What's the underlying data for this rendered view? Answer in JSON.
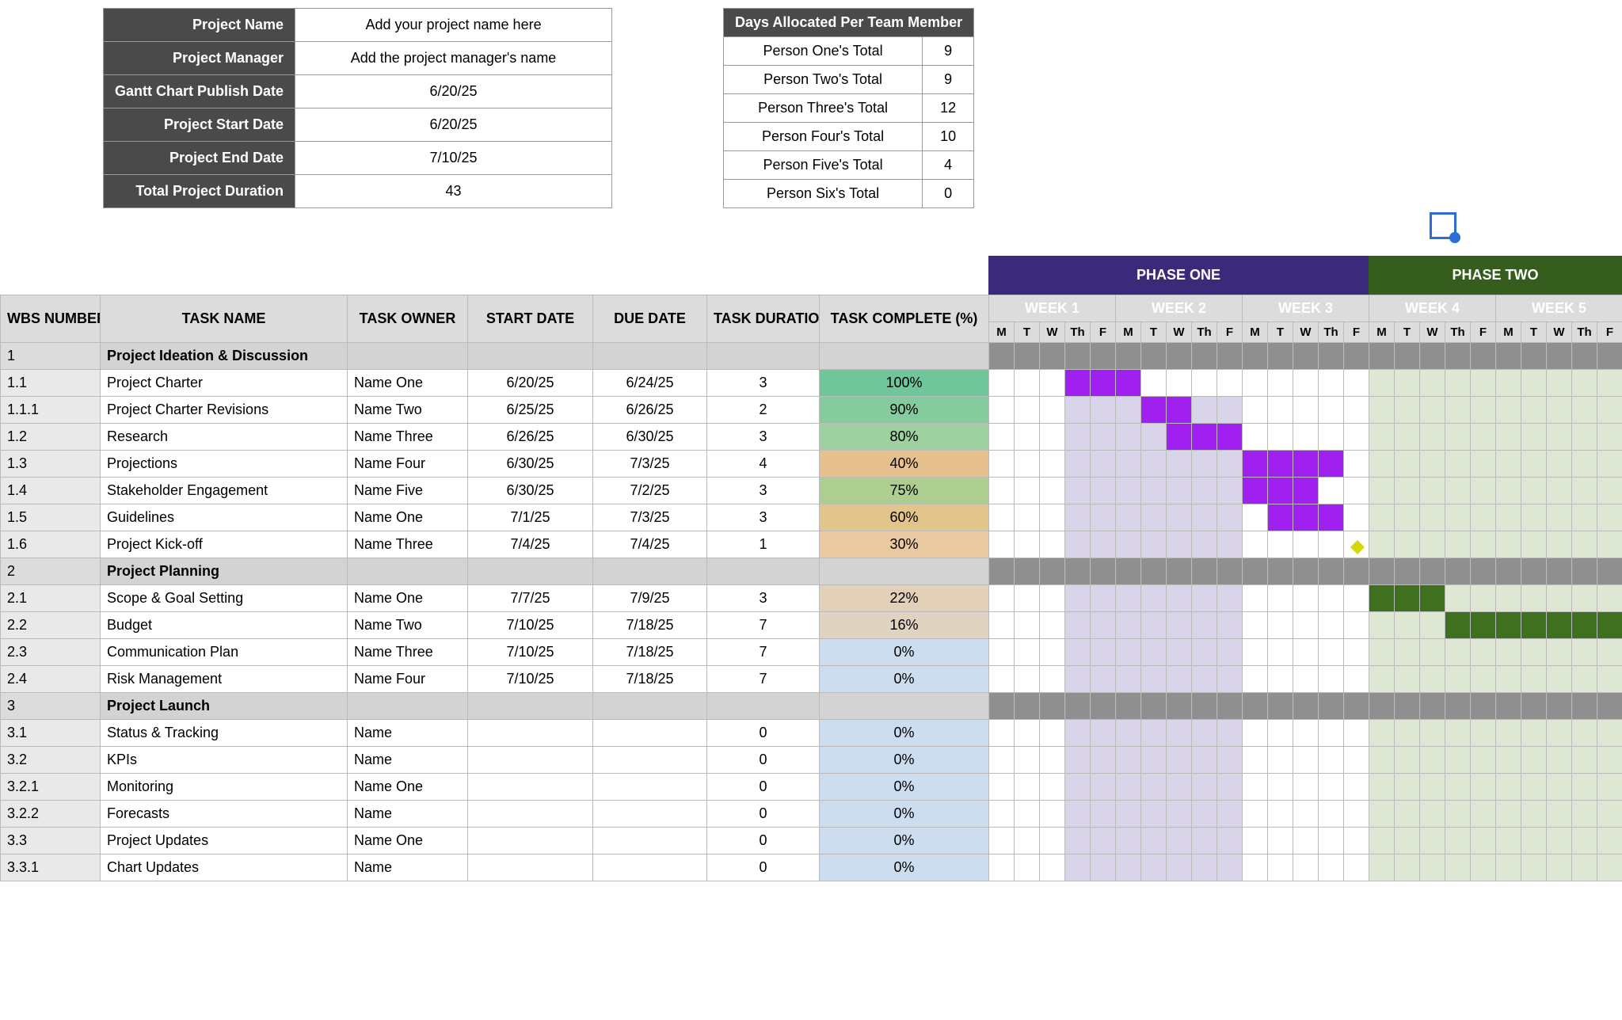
{
  "project_info": {
    "labels": {
      "name": "Project Name",
      "manager": "Project Manager",
      "publish": "Gantt Chart Publish Date",
      "start": "Project Start Date",
      "end": "Project End Date",
      "duration": "Total Project Duration"
    },
    "values": {
      "name": "Add your project name here",
      "manager": "Add the project manager's name",
      "publish": "6/20/25",
      "start": "6/20/25",
      "end": "7/10/25",
      "duration": "43"
    }
  },
  "team_alloc": {
    "header": "Days Allocated Per Team Member",
    "rows": [
      {
        "label": "Person One's Total",
        "days": "9"
      },
      {
        "label": "Person Two's Total",
        "days": "9"
      },
      {
        "label": "Person Three's Total",
        "days": "12"
      },
      {
        "label": "Person Four's Total",
        "days": "10"
      },
      {
        "label": "Person Five's Total",
        "days": "4"
      },
      {
        "label": "Person Six's Total",
        "days": "0"
      }
    ]
  },
  "phases": [
    {
      "label": "PHASE ONE",
      "class": "phase-purple",
      "span": 15
    },
    {
      "label": "PHASE TWO",
      "class": "phase-green",
      "span": 10
    }
  ],
  "columns": {
    "wbs": "WBS NUMBER",
    "task": "TASK NAME",
    "owner": "TASK OWNER",
    "start": "START DATE",
    "due": "DUE DATE",
    "duration": "TASK DURATION",
    "pct": "TASK COMPLETE (%)"
  },
  "weeks": [
    {
      "label": "WEEK 1",
      "class": "week-hdr-purple",
      "days": [
        "M",
        "T",
        "W",
        "Th",
        "F"
      ]
    },
    {
      "label": "WEEK 2",
      "class": "week-hdr-purple",
      "days": [
        "M",
        "T",
        "W",
        "Th",
        "F"
      ]
    },
    {
      "label": "WEEK 3",
      "class": "week-hdr-purple",
      "days": [
        "M",
        "T",
        "W",
        "Th",
        "F"
      ]
    },
    {
      "label": "WEEK 4",
      "class": "week-hdr-green",
      "days": [
        "M",
        "T",
        "W",
        "Th",
        "F"
      ]
    },
    {
      "label": "WEEK 5",
      "class": "week-hdr-green",
      "days": [
        "M",
        "T",
        "W",
        "Th",
        "F"
      ]
    }
  ],
  "chart_data": {
    "type": "gantt",
    "days_total": 25,
    "phase_one_days": 15,
    "rows": [
      {
        "section": true,
        "wbs": "1",
        "task": "Project Ideation & Discussion"
      },
      {
        "wbs": "1.1",
        "task": "Project Charter",
        "owner": "Name One",
        "start": "6/20/25",
        "due": "6/24/25",
        "dur": "3",
        "pct": "100%",
        "pct_cls": "pct-100",
        "bar_start": 3,
        "bar_len": 3,
        "shade_from": 0,
        "shade_to": 0
      },
      {
        "wbs": "1.1.1",
        "task": "Project Charter Revisions",
        "owner": "Name Two",
        "start": "6/25/25",
        "due": "6/26/25",
        "dur": "2",
        "pct": "90%",
        "pct_cls": "pct-90",
        "bar_start": 6,
        "bar_len": 2,
        "shade_from": 3,
        "shade_to": 10
      },
      {
        "wbs": "1.2",
        "task": "Research",
        "owner": "Name Three",
        "start": "6/26/25",
        "due": "6/30/25",
        "dur": "3",
        "pct": "80%",
        "pct_cls": "pct-80",
        "bar_start": 7,
        "bar_len": 3,
        "shade_from": 3,
        "shade_to": 10
      },
      {
        "wbs": "1.3",
        "task": "Projections",
        "owner": "Name Four",
        "start": "6/30/25",
        "due": "7/3/25",
        "dur": "4",
        "pct": "40%",
        "pct_cls": "pct-40",
        "bar_start": 10,
        "bar_len": 4,
        "shade_from": 3,
        "shade_to": 10
      },
      {
        "wbs": "1.4",
        "task": "Stakeholder Engagement",
        "owner": "Name Five",
        "start": "6/30/25",
        "due": "7/2/25",
        "dur": "3",
        "pct": "75%",
        "pct_cls": "pct-75",
        "bar_start": 10,
        "bar_len": 3,
        "shade_from": 3,
        "shade_to": 10
      },
      {
        "wbs": "1.5",
        "task": "Guidelines",
        "owner": "Name One",
        "start": "7/1/25",
        "due": "7/3/25",
        "dur": "3",
        "pct": "60%",
        "pct_cls": "pct-60",
        "bar_start": 11,
        "bar_len": 3,
        "shade_from": 3,
        "shade_to": 10
      },
      {
        "wbs": "1.6",
        "task": "Project Kick-off",
        "owner": "Name Three",
        "start": "7/4/25",
        "due": "7/4/25",
        "dur": "1",
        "pct": "30%",
        "pct_cls": "pct-30",
        "milestone_at": 14,
        "shade_from": 3,
        "shade_to": 10
      },
      {
        "section": true,
        "wbs": "2",
        "task": "Project Planning"
      },
      {
        "wbs": "2.1",
        "task": "Scope & Goal Setting",
        "owner": "Name One",
        "start": "7/7/25",
        "due": "7/9/25",
        "dur": "3",
        "pct": "22%",
        "pct_cls": "pct-22",
        "bar_start": 15,
        "bar_len": 3,
        "bar_cls": "bar-green",
        "shade_from": 3,
        "shade_to": 10
      },
      {
        "wbs": "2.2",
        "task": "Budget",
        "owner": "Name Two",
        "start": "7/10/25",
        "due": "7/18/25",
        "dur": "7",
        "pct": "16%",
        "pct_cls": "pct-16",
        "bar_start": 18,
        "bar_len": 7,
        "bar_cls": "bar-green",
        "shade_from": 3,
        "shade_to": 10
      },
      {
        "wbs": "2.3",
        "task": "Communication Plan",
        "owner": "Name Three",
        "start": "7/10/25",
        "due": "7/18/25",
        "dur": "7",
        "pct": "0%",
        "pct_cls": "pct-0",
        "shade_from": 3,
        "shade_to": 10
      },
      {
        "wbs": "2.4",
        "task": "Risk Management",
        "owner": "Name Four",
        "start": "7/10/25",
        "due": "7/18/25",
        "dur": "7",
        "pct": "0%",
        "pct_cls": "pct-0",
        "shade_from": 3,
        "shade_to": 10
      },
      {
        "section": true,
        "wbs": "3",
        "task": "Project Launch"
      },
      {
        "wbs": "3.1",
        "task": "Status & Tracking",
        "owner": "Name",
        "start": "",
        "due": "",
        "dur": "0",
        "pct": "0%",
        "pct_cls": "pct-0",
        "shade_from": 3,
        "shade_to": 10
      },
      {
        "wbs": "3.2",
        "task": "KPIs",
        "owner": "Name",
        "start": "",
        "due": "",
        "dur": "0",
        "pct": "0%",
        "pct_cls": "pct-0",
        "shade_from": 3,
        "shade_to": 10
      },
      {
        "wbs": "3.2.1",
        "task": "Monitoring",
        "owner": "Name One",
        "start": "",
        "due": "",
        "dur": "0",
        "pct": "0%",
        "pct_cls": "pct-0",
        "shade_from": 3,
        "shade_to": 10
      },
      {
        "wbs": "3.2.2",
        "task": "Forecasts",
        "owner": "Name",
        "start": "",
        "due": "",
        "dur": "0",
        "pct": "0%",
        "pct_cls": "pct-0",
        "shade_from": 3,
        "shade_to": 10
      },
      {
        "wbs": "3.3",
        "task": "Project Updates",
        "owner": "Name One",
        "start": "",
        "due": "",
        "dur": "0",
        "pct": "0%",
        "pct_cls": "pct-0",
        "shade_from": 3,
        "shade_to": 10
      },
      {
        "wbs": "3.3.1",
        "task": "Chart Updates",
        "owner": "Name",
        "start": "",
        "due": "",
        "dur": "0",
        "pct": "0%",
        "pct_cls": "pct-0",
        "shade_from": 3,
        "shade_to": 10
      }
    ]
  }
}
